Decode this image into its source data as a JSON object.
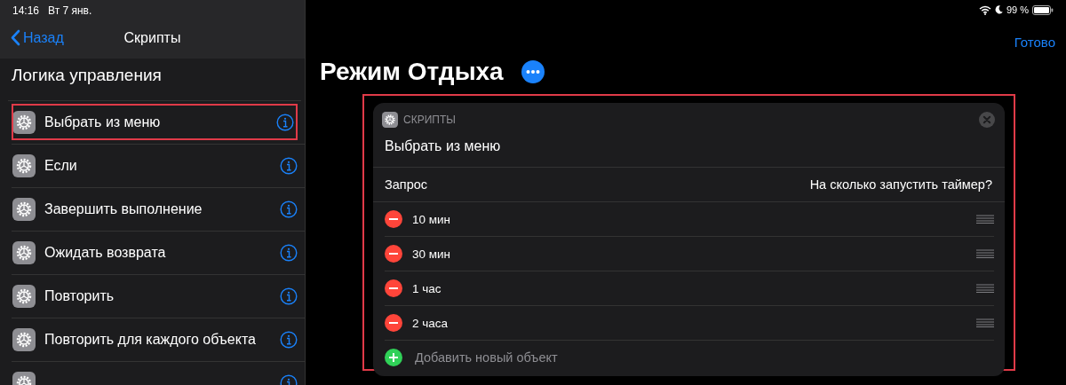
{
  "status_bar": {
    "time": "14:16",
    "date": "Вт 7 янв.",
    "battery": "99 %"
  },
  "sidebar": {
    "back": "Назад",
    "title": "Скрипты",
    "section": "Логика управления",
    "items": [
      {
        "label": "Выбрать из меню",
        "highlighted": true
      },
      {
        "label": "Если",
        "highlighted": false
      },
      {
        "label": "Завершить выполнение",
        "highlighted": false
      },
      {
        "label": "Ожидать возврата",
        "highlighted": false
      },
      {
        "label": "Повторить",
        "highlighted": false
      },
      {
        "label": "Повторить для каждого объекта",
        "highlighted": false
      },
      {
        "highlighted": false
      }
    ]
  },
  "toolbar": {
    "done": "Готово"
  },
  "shortcut": {
    "title": "Режим Отдыха"
  },
  "action_card": {
    "highlighted": true,
    "app": "СКРИПТЫ",
    "title": "Выбрать из меню",
    "prompt_label": "Запрос",
    "prompt_value": "На сколько запустить таймер?",
    "options": [
      "10 мин",
      "30 мин",
      "1 час",
      "2 часа"
    ],
    "add": "Добавить новый объект"
  }
}
